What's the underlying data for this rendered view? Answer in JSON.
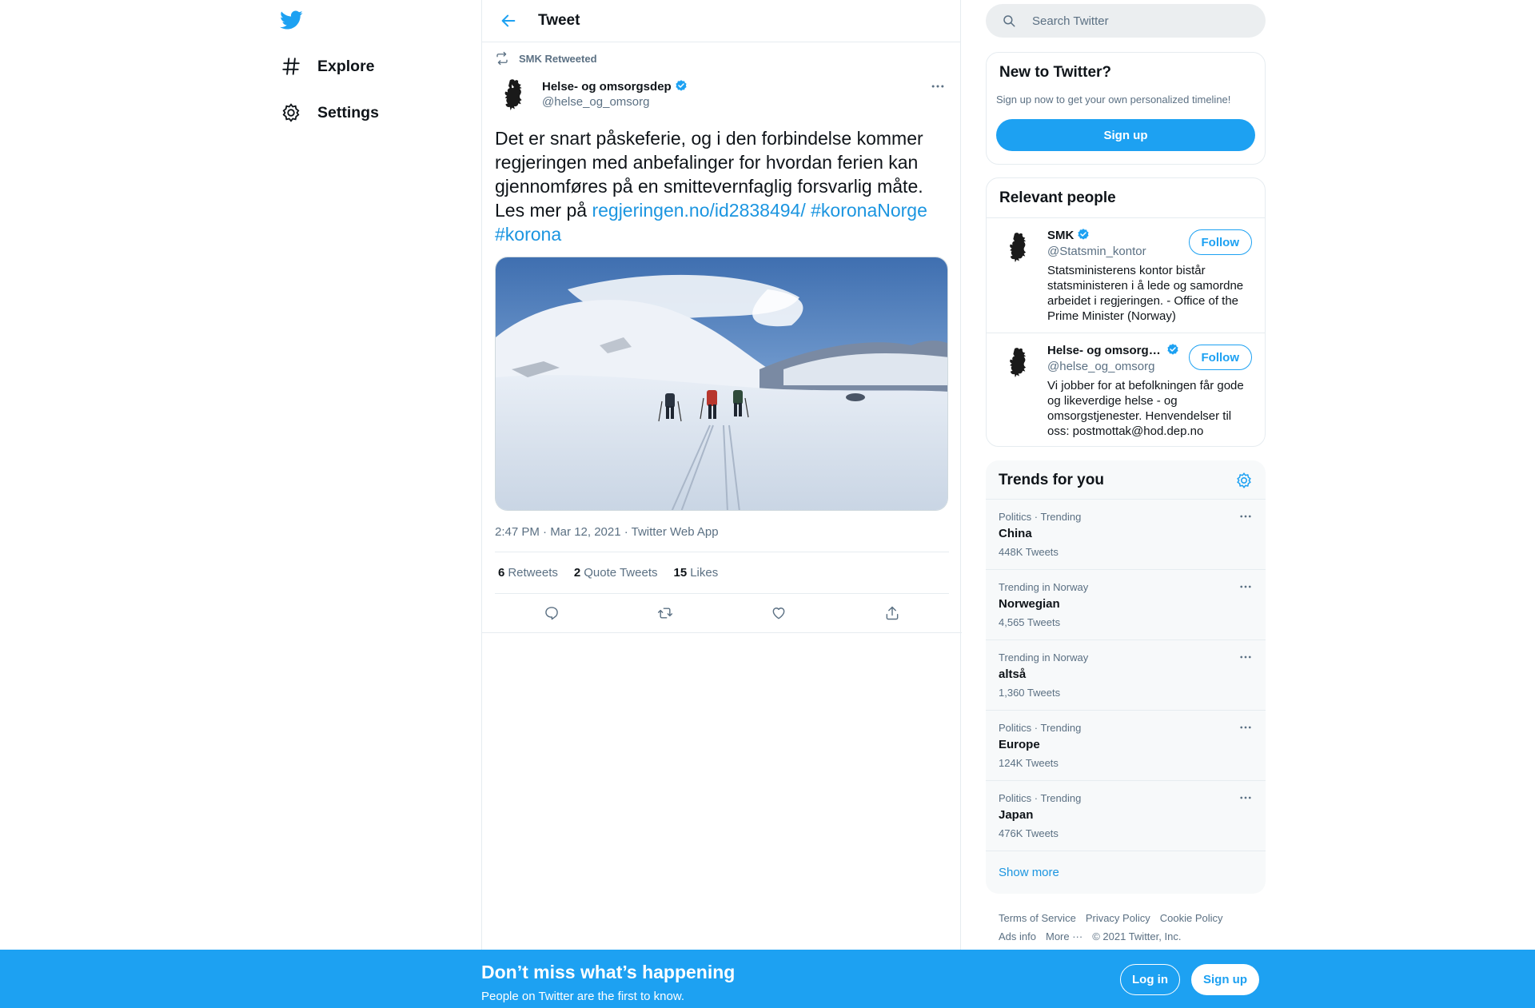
{
  "nav": {
    "logo_icon": "twitter-bird-icon",
    "items": [
      {
        "label": "Explore",
        "icon": "hashtag-icon"
      },
      {
        "label": "Settings",
        "icon": "gear-icon"
      }
    ]
  },
  "header": {
    "title": "Tweet",
    "back_icon": "arrow-left-icon"
  },
  "tweet": {
    "retweeted_by": "SMK Retweeted",
    "author_name": "Helse- og omsorgsdep",
    "author_handle": "@helse_og_omsorg",
    "text_plain": "Det er snart påskeferie, og i den forbindelse kommer regjeringen med anbefalinger for hvordan ferien kan gjennomføres på en smittevernfaglig forsvarlig måte. Les mer på ",
    "link": "regjeringen.no/id2838494/",
    "hashtag1": "#koronaNorge",
    "hashtag2": "#korona",
    "time": "2:47 PM · Mar 12, 2021 · ",
    "source": "Twitter Web App",
    "stats": {
      "retweets_count": "6",
      "retweets_label": "Retweets",
      "quotes_count": "2",
      "quotes_label": "Quote Tweets",
      "likes_count": "15",
      "likes_label": "Likes"
    }
  },
  "search": {
    "placeholder": "Search Twitter"
  },
  "new_to_twitter": {
    "title": "New to Twitter?",
    "subtitle": "Sign up now to get your own personalized timeline!",
    "button": "Sign up"
  },
  "relevant_people": {
    "title": "Relevant people",
    "people": [
      {
        "name": "SMK",
        "handle": "@Statsmin_kontor",
        "bio": "Statsministerens kontor bistår statsministeren i å lede og samordne arbeidet i regjeringen. - Office of the Prime Minister (Norway)",
        "button": "Follow"
      },
      {
        "name": "Helse- og omsorgsdep",
        "handle": "@helse_og_omsorg",
        "bio": "Vi jobber for at befolkningen får gode og likeverdige helse - og omsorgstjenester. Henvendelser til oss: postmottak@hod.dep.no",
        "button": "Follow"
      }
    ]
  },
  "trends": {
    "title": "Trends for you",
    "items": [
      {
        "context": "Politics · Trending",
        "name": "China",
        "count": "448K Tweets"
      },
      {
        "context": "Trending in Norway",
        "name": "Norwegian",
        "count": "4,565 Tweets"
      },
      {
        "context": "Trending in Norway",
        "name": "altså",
        "count": "1,360 Tweets"
      },
      {
        "context": "Politics · Trending",
        "name": "Europe",
        "count": "124K Tweets"
      },
      {
        "context": "Politics · Trending",
        "name": "Japan",
        "count": "476K Tweets"
      }
    ],
    "show_more": "Show more"
  },
  "footer": {
    "terms": "Terms of Service",
    "privacy": "Privacy Policy",
    "cookie": "Cookie Policy",
    "ads": "Ads info",
    "more": "More ···",
    "copyright": "© 2021 Twitter, Inc."
  },
  "bottom_bar": {
    "title": "Don’t miss what’s happening",
    "subtitle": "People on Twitter are the first to know.",
    "login": "Log in",
    "signup": "Sign up"
  },
  "colors": {
    "accent": "#1da1f2",
    "link": "#1b95e0",
    "secondary_text": "#5b7083",
    "border": "#e6ecf0"
  }
}
